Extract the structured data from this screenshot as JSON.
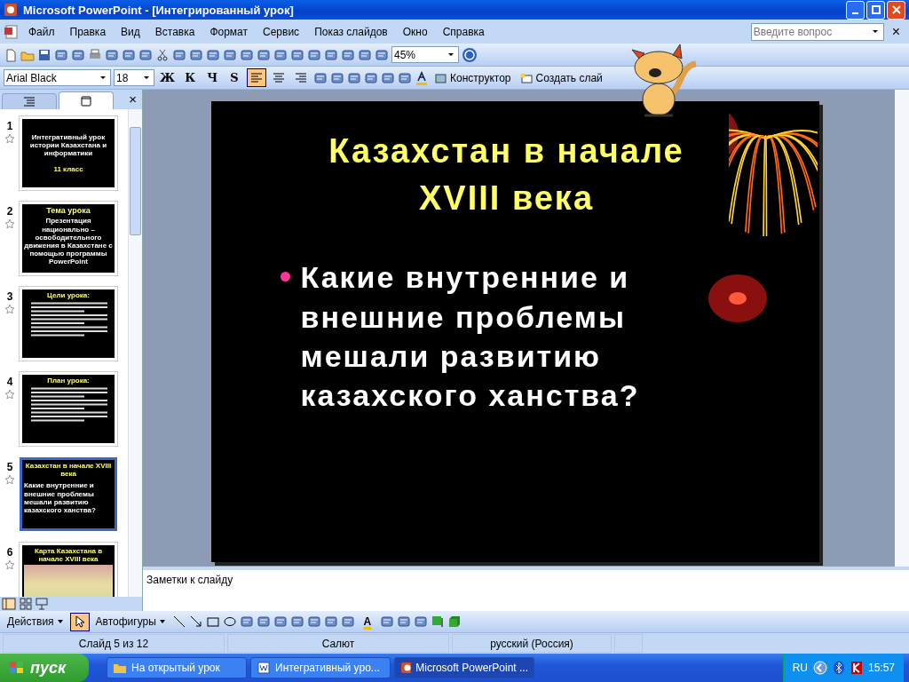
{
  "window": {
    "title": "Microsoft PowerPoint - [Интегрированный урок]"
  },
  "menu": {
    "items": [
      "Файл",
      "Правка",
      "Вид",
      "Вставка",
      "Формат",
      "Сервис",
      "Показ слайдов",
      "Окно",
      "Справка"
    ],
    "help_search": {
      "placeholder": "Введите вопрос"
    },
    "close_glyph": "×"
  },
  "standard_toolbar": {
    "zoom": "45%"
  },
  "formatting_toolbar": {
    "font": "Arial Black",
    "size": "18",
    "style_buttons": [
      {
        "label": "Ж",
        "selected": false
      },
      {
        "label": "К",
        "selected": false
      },
      {
        "label": "Ч",
        "selected": false
      },
      {
        "label": "S",
        "selected": false
      }
    ],
    "align_buttons": [
      {
        "selected": true
      },
      {
        "selected": false
      },
      {
        "selected": false
      }
    ],
    "designer": "Конструктор",
    "new_slide": "Создать слай"
  },
  "panel": {
    "tabs": [
      {
        "kind": "outline",
        "selected": false
      },
      {
        "kind": "slides",
        "selected": true
      }
    ],
    "close_glyph": "×",
    "slides": [
      {
        "number": "1",
        "selected": false,
        "kind": "title",
        "title": "Интегративный урок истории Казахстана и информатики",
        "subtitle": "11 класс"
      },
      {
        "number": "2",
        "selected": false,
        "kind": "heading",
        "title": "Тема урока",
        "body": "Презентация национально – освободительного движения в Казахстане с помощью программы PowerPoint"
      },
      {
        "number": "3",
        "selected": false,
        "kind": "list",
        "title": "Цели урока:"
      },
      {
        "number": "4",
        "selected": false,
        "kind": "list",
        "title": "План урока:"
      },
      {
        "number": "5",
        "selected": true,
        "kind": "bullet",
        "title": "Казахстан в начале XVIII века",
        "body": "Какие внутренние  и внешние проблемы мешали развитию казахского ханства?"
      },
      {
        "number": "6",
        "selected": false,
        "kind": "map",
        "title": "Карта Казахстана в начале XVIII века"
      }
    ]
  },
  "slide": {
    "title": "Казахстан в начале XVIII века",
    "bullets": [
      "Какие внутренние  и внешние проблемы мешали развитию казахского ханства?"
    ]
  },
  "notes": {
    "placeholder": "Заметки к слайду"
  },
  "drawing_toolbar": {
    "actions": "Действия",
    "autoshapes": "Автофигуры",
    "font_color_glyph": "A"
  },
  "status_bar": [
    "Слайд 5 из 12",
    "Салют",
    "русский (Россия)"
  ],
  "taskbar": {
    "start": "пуск",
    "tasks": [
      {
        "label": "На открытый урок",
        "kind": "folder",
        "selected": false
      },
      {
        "label": "Интегративный уро...",
        "kind": "word",
        "selected": false
      },
      {
        "label": "Microsoft PowerPoint ...",
        "kind": "powerpoint",
        "selected": true
      }
    ],
    "language": "RU",
    "clock": "15:57"
  }
}
